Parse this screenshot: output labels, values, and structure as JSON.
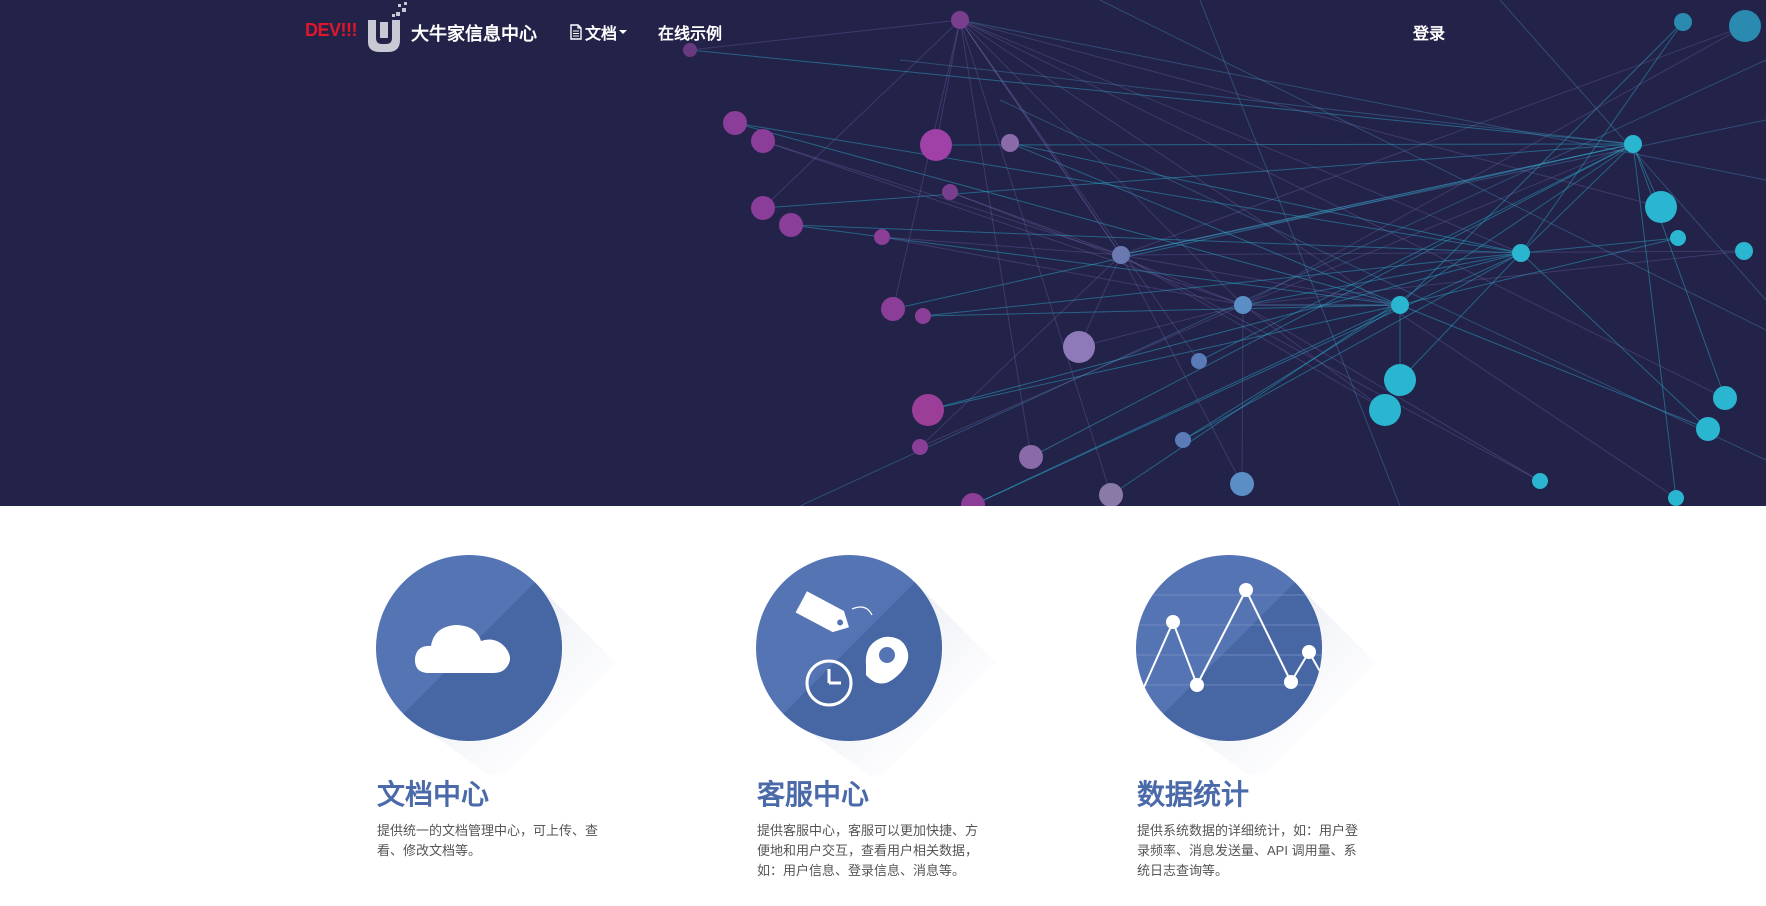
{
  "header": {
    "dev_badge": "DEV!!!",
    "brand_name": "大牛家信息中心",
    "nav": {
      "docs_label": "文档",
      "demo_label": "在线示例",
      "login_label": "登录"
    }
  },
  "features": [
    {
      "title": "文档中心",
      "description": "提供统一的文档管理中心，可上传、查看、修改文档等。",
      "icon": "cloud-icon"
    },
    {
      "title": "客服中心",
      "description": "提供客服中心，客服可以更加快捷、方便地和用户交互，查看用户相关数据，如：用户信息、登录信息、消息等。",
      "icon": "tag-clock-pin-icon"
    },
    {
      "title": "数据统计",
      "description": "提供系统数据的详细统计，如：用户登录频率、消息发送量、API 调用量、系统日志查询等。",
      "icon": "line-chart-icon"
    }
  ],
  "colors": {
    "hero_bg": "#232249",
    "accent_blue": "#4a6aaa",
    "dev_red": "#e0172a",
    "node_purple": "#8b3d9a",
    "node_cyan": "#2ab5d0"
  }
}
